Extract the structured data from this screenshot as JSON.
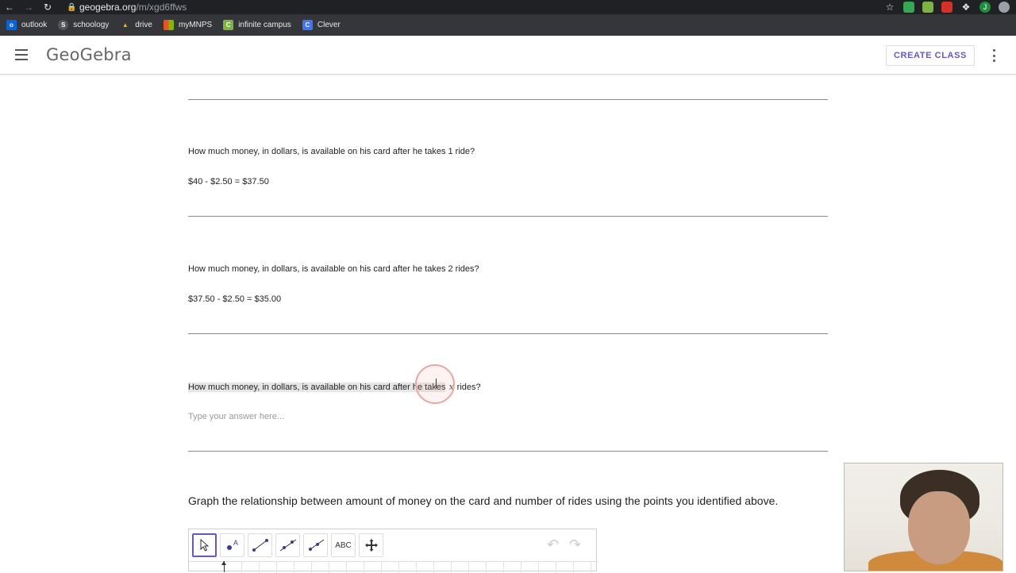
{
  "browser": {
    "url_host": "geogebra.org",
    "url_path": "/m/xgd6ffws",
    "bookmarks": [
      {
        "label": "outlook",
        "color": "#0a64d8"
      },
      {
        "label": "schoology",
        "color": "#555555"
      },
      {
        "label": "drive",
        "color": "#1fa463"
      },
      {
        "label": "myMNPS",
        "color": "#f4b400"
      },
      {
        "label": "infinite campus",
        "color": "#7cb342"
      },
      {
        "label": "Clever",
        "color": "#4274f6"
      }
    ],
    "bookmark_icon_letters": [
      "o",
      "S",
      "▲",
      "▦",
      "C",
      "C"
    ],
    "profile_letter": "J"
  },
  "header": {
    "logo": "GeoGebra",
    "create_class_label": "CREATE CLASS",
    "accent_color": "#6557d2"
  },
  "questions": [
    {
      "text": "How much money, in dollars, is available on his card after he takes 1 ride?",
      "answer": "$40 - $2.50 = $37.50"
    },
    {
      "text": "How much money, in dollars, is available on his card after he takes 2 rides?",
      "answer": "$37.50 - $2.50 = $35.00"
    },
    {
      "text_before": "How much money, in dollars, is available on his card after he takes",
      "math_var": "x",
      "text_after": "rides?",
      "placeholder": "Type your answer here..."
    }
  ],
  "graph": {
    "title": "Graph the relationship between amount of money on the card and number of rides using the points you identified above.",
    "tools": [
      "move-tool",
      "point-tool",
      "segment-tool",
      "line-tool",
      "ray-tool",
      "text-tool",
      "move-graphics-tool"
    ],
    "text_tool_label": "ABC"
  }
}
